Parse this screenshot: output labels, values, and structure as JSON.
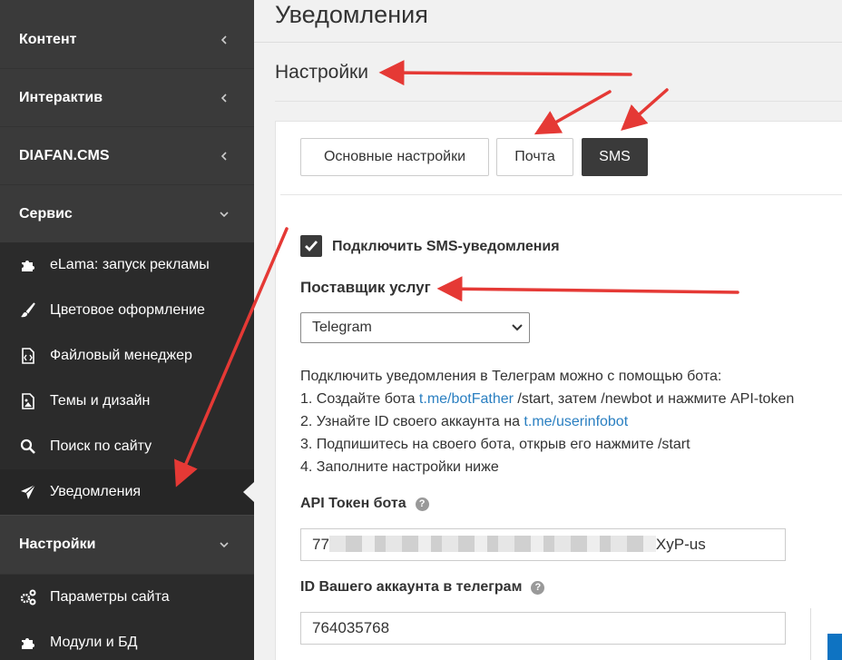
{
  "sidebar": {
    "groups": [
      {
        "label": "Контент",
        "chevron": "chevron-left-icon"
      },
      {
        "label": "Интерактив",
        "chevron": "chevron-left-icon"
      },
      {
        "label": "DIAFAN.CMS",
        "chevron": "chevron-left-icon"
      },
      {
        "label": "Сервис",
        "chevron": "chevron-down-icon"
      },
      {
        "label": "Настройки",
        "chevron": "chevron-down-icon"
      }
    ],
    "service_items": [
      {
        "label": "eLama: запуск рекламы",
        "icon": "puzzle-icon"
      },
      {
        "label": "Цветовое оформление",
        "icon": "brush-icon"
      },
      {
        "label": "Файловый менеджер",
        "icon": "file-code-icon"
      },
      {
        "label": "Темы и дизайн",
        "icon": "image-file-icon"
      },
      {
        "label": "Поиск по сайту",
        "icon": "search-icon"
      },
      {
        "label": "Уведомления",
        "icon": "paper-plane-icon"
      }
    ],
    "settings_items": [
      {
        "label": "Параметры сайта",
        "icon": "gears-icon"
      },
      {
        "label": "Модули и БД",
        "icon": "puzzle-icon"
      }
    ]
  },
  "page": {
    "title": "Уведомления",
    "section_title": "Настройки"
  },
  "tabs": [
    {
      "label": "Основные настройки",
      "active": false
    },
    {
      "label": "Почта",
      "active": false
    },
    {
      "label": "SMS",
      "active": true
    }
  ],
  "form": {
    "enable_sms_label": "Подключить SMS-уведомления",
    "enable_sms_checked": true,
    "provider_label": "Поставщик услуг",
    "provider_value": "Telegram",
    "info": {
      "intro": "Подключить уведомления в Телеграм можно с помощью бота:",
      "step1_prefix": "1. Создайте бота ",
      "step1_link": "t.me/botFather",
      "step1_suffix": " /start, затем /newbot и нажмите API-token",
      "step2_prefix": "2. Узнайте ID своего аккаунта на ",
      "step2_link": "t.me/userinfobot",
      "step3": "3. Подпишитесь на своего бота, открыв его нажмите /start",
      "step4": "4. Заполните настройки ниже"
    },
    "api_token_label": "API Токен бота",
    "api_token_prefix": "77",
    "api_token_suffix": "XyP-us",
    "account_id_label": "ID Вашего аккаунта в телеграм",
    "account_id_value": "764035768"
  },
  "colors": {
    "sidebar_bg": "#3a3a3a",
    "sidebar_sub_bg": "#2b2b2b",
    "link": "#2a7fc1",
    "annotation_arrow": "#e53935"
  }
}
